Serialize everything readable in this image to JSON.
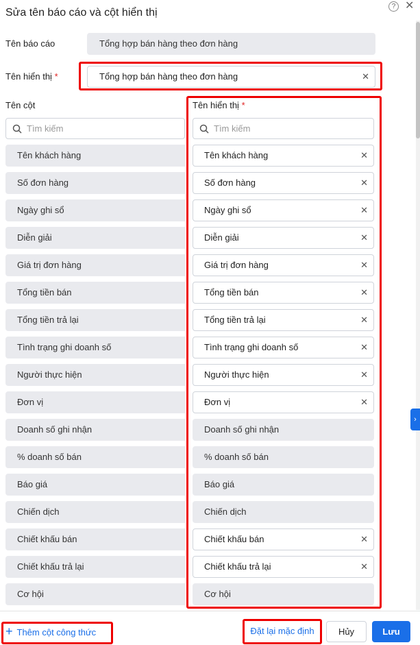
{
  "dialog": {
    "title": "Sửa tên báo cáo và cột hiển thị",
    "help_icon": "?",
    "close_icon": "✕"
  },
  "report_name": {
    "label": "Tên báo cáo",
    "value": "Tổng hợp bán hàng theo đơn hàng"
  },
  "display_name": {
    "label": "Tên hiển thị",
    "required": "*",
    "value": "Tổng hợp bán hàng theo đơn hàng"
  },
  "columns": {
    "left_header": "Tên cột",
    "right_header": "Tên hiển thị",
    "right_required": "*",
    "search_placeholder": "Tìm kiếm",
    "rows": [
      {
        "name": "Tên khách hàng",
        "display": "Tên khách hàng",
        "editable": true
      },
      {
        "name": "Số đơn hàng",
        "display": "Số đơn hàng",
        "editable": true
      },
      {
        "name": "Ngày ghi sổ",
        "display": "Ngày ghi sổ",
        "editable": true
      },
      {
        "name": "Diễn giải",
        "display": "Diễn giải",
        "editable": true
      },
      {
        "name": "Giá trị đơn hàng",
        "display": "Giá trị đơn hàng",
        "editable": true
      },
      {
        "name": "Tổng tiền bán",
        "display": "Tổng tiền bán",
        "editable": true
      },
      {
        "name": "Tổng tiền trả lại",
        "display": "Tổng tiền trả lại",
        "editable": true
      },
      {
        "name": "Tình trạng ghi doanh số",
        "display": "Tình trạng ghi doanh số",
        "editable": true
      },
      {
        "name": "Người thực hiện",
        "display": "Người thực hiện",
        "editable": true
      },
      {
        "name": "Đơn vị",
        "display": "Đơn vị",
        "editable": true
      },
      {
        "name": "Doanh số ghi nhận",
        "display": "Doanh số ghi nhận",
        "editable": false
      },
      {
        "name": "% doanh số bán",
        "display": "% doanh số bán",
        "editable": false
      },
      {
        "name": "Báo giá",
        "display": "Báo giá",
        "editable": false
      },
      {
        "name": "Chiến dịch",
        "display": "Chiến dịch",
        "editable": false
      },
      {
        "name": "Chiết khấu bán",
        "display": "Chiết khấu bán",
        "editable": true
      },
      {
        "name": "Chiết khấu trả lại",
        "display": "Chiết khấu trả lại",
        "editable": true
      },
      {
        "name": "Cơ hội",
        "display": "Cơ hội",
        "editable": false
      }
    ]
  },
  "footer": {
    "add_formula": "Thêm cột công thức",
    "add_icon": "+",
    "reset": "Đặt lại mặc định",
    "cancel": "Hủy",
    "save": "Lưu"
  },
  "clear_icon": "✕",
  "side_tab_icon": "›",
  "colors": {
    "primary": "#1a6fe8",
    "highlight": "#ee0000",
    "readonly_bg": "#e9eaee"
  }
}
